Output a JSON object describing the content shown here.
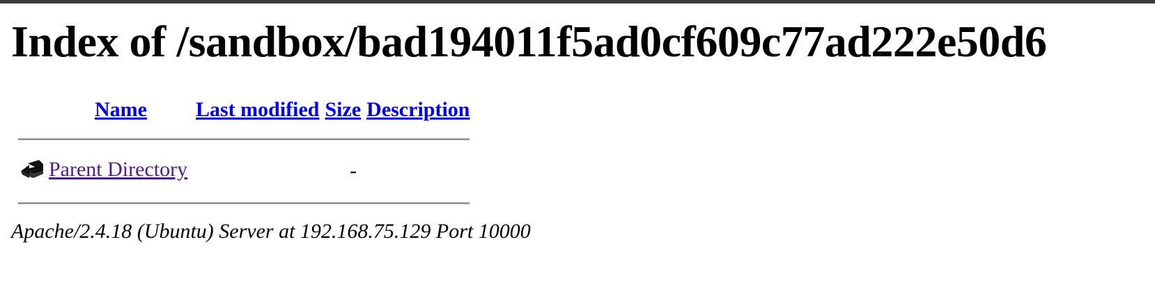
{
  "page": {
    "title": "Index of /sandbox/bad194011f5ad0cf609c77ad222e50d6"
  },
  "table": {
    "columns": {
      "name": "Name",
      "last_modified": "Last modified",
      "size": "Size",
      "description": "Description"
    },
    "rows": [
      {
        "icon": "back-arrow-icon",
        "name": "Parent Directory",
        "last_modified": "",
        "size": "-",
        "description": ""
      }
    ]
  },
  "footer": {
    "server_signature": "Apache/2.4.18 (Ubuntu) Server at 192.168.75.129 Port 10000"
  },
  "colors": {
    "link": "#0000ee",
    "visited_link": "#551a8b",
    "rule": "#888888"
  }
}
